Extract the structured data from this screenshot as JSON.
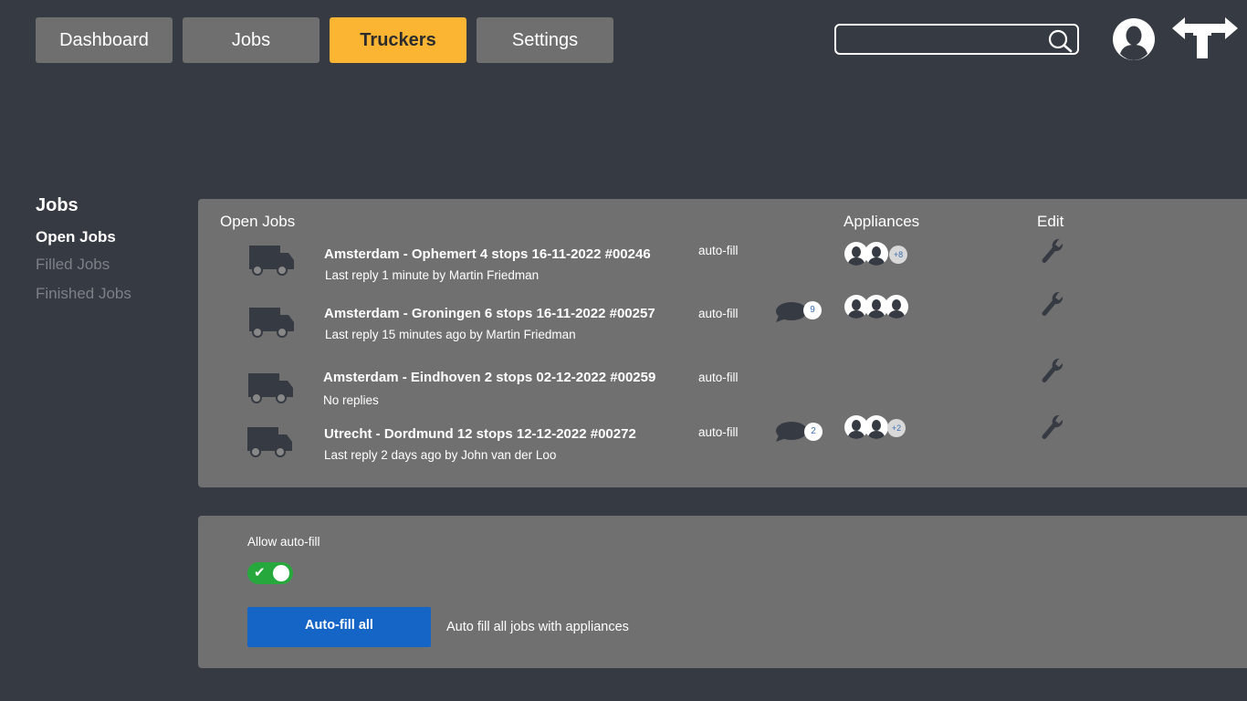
{
  "nav": {
    "tabs": [
      {
        "label": "Dashboard"
      },
      {
        "label": "Jobs"
      },
      {
        "label": "Truckers"
      },
      {
        "label": "Settings"
      }
    ],
    "active_tab": "Truckers",
    "search_placeholder": "",
    "icons": [
      "search-icon",
      "user-avatar-icon",
      "directions-sign-icon"
    ]
  },
  "sidebar": {
    "title": "Jobs",
    "items": [
      {
        "label": "Open Jobs"
      },
      {
        "label": "Filled Jobs"
      },
      {
        "label": "Finished Jobs"
      }
    ]
  },
  "jobs_panel": {
    "header": "Open Jobs",
    "col_appliances": "Appliances",
    "col_edit": "Edit",
    "jobs": [
      {
        "title": "Amsterdam - Ophemert 4 stops 16-11-2022 #00246",
        "subtitle": "Last reply 1 minute by Martin Friedman",
        "autofill": "auto-fill",
        "messages": "",
        "appliances_extra": "+8"
      },
      {
        "title": "Amsterdam - Groningen 6 stops 16-11-2022 #00257",
        "subtitle": "Last reply 15 minutes ago by Martin Friedman",
        "autofill": "auto-fill",
        "messages": "9",
        "appliances_extra": ""
      },
      {
        "title": "Amsterdam - Eindhoven 2 stops 02-12-2022 #00259",
        "subtitle": "No replies",
        "autofill": "auto-fill",
        "messages": "",
        "appliances_extra": ""
      },
      {
        "title": "Utrecht - Dordmund 12 stops 12-12-2022 #00272",
        "subtitle": "Last reply 2 days ago by John van der Loo",
        "autofill": "auto-fill",
        "messages": "2",
        "appliances_extra": "+2"
      }
    ]
  },
  "autofill_panel": {
    "label": "Allow auto-fill",
    "toggle_on": true,
    "toggle_check": "✔",
    "button_label": "Auto-fill all",
    "description": "Auto fill all jobs with appliances"
  },
  "colors": {
    "background": "#363a42",
    "panel": "#707070",
    "nav_button": "#6f6f6f",
    "nav_active": "#fbb533",
    "toggle_on": "#27a83d",
    "primary_button": "#1565c6"
  }
}
